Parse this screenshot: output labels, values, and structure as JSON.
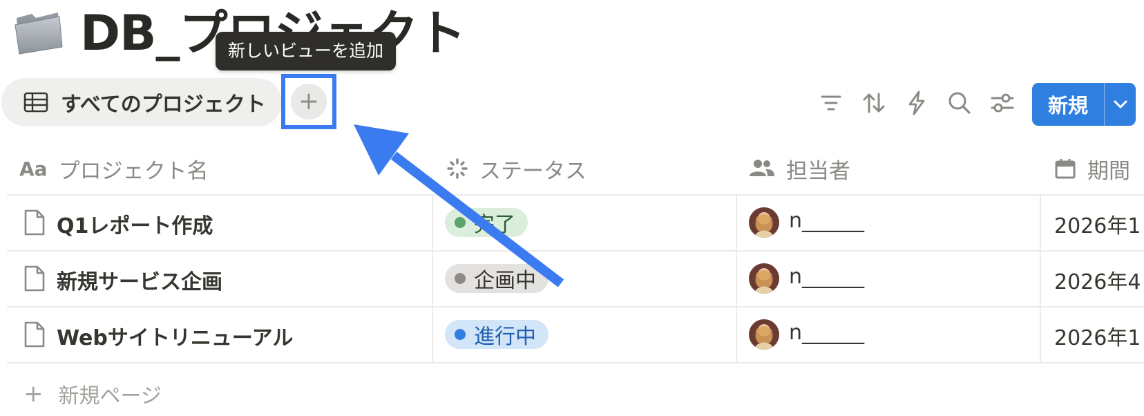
{
  "page": {
    "title": "DB_プロジェクト",
    "icon": "folder-icon"
  },
  "tooltip": {
    "text": "新しいビューを追加"
  },
  "view_tabs": [
    {
      "label": "すべてのプロジェクト",
      "icon": "table-icon"
    }
  ],
  "add_view": {
    "label": "+",
    "icon": "plus-icon"
  },
  "toolbar": {
    "icons": [
      "filter-icon",
      "sort-icon",
      "automation-icon",
      "search-icon",
      "settings-sliders-icon"
    ],
    "new_button": {
      "label": "新規",
      "dropdown_icon": "chevron-down-icon",
      "color": "#2f7fe0"
    }
  },
  "table": {
    "columns": [
      {
        "label": "プロジェクト名",
        "icon": "Aa"
      },
      {
        "label": "ステータス",
        "icon": "status-icon"
      },
      {
        "label": "担当者",
        "icon": "people-icon"
      },
      {
        "label": "期間",
        "icon": "calendar-icon"
      }
    ],
    "rows": [
      {
        "title": "Q1レポート作成",
        "status": "完了",
        "status_color": "#dbeddb",
        "dot_color": "#5aa46c",
        "assignee": "n______",
        "date": "2026年1"
      },
      {
        "title": "新規サービス企画",
        "status": "企画中",
        "status_color": "#e3e2e0",
        "dot_color": "#8e8b86",
        "assignee": "n______",
        "date": "2026年4"
      },
      {
        "title": "Webサイトリニューアル",
        "status": "進行中",
        "status_color": "#d3e5f9",
        "dot_color": "#2f7fe0",
        "assignee": "n______",
        "date": "2026年1"
      }
    ],
    "new_page": {
      "label": "新規ページ"
    }
  },
  "colors": {
    "annotation_blue": "#3a7bf0"
  }
}
